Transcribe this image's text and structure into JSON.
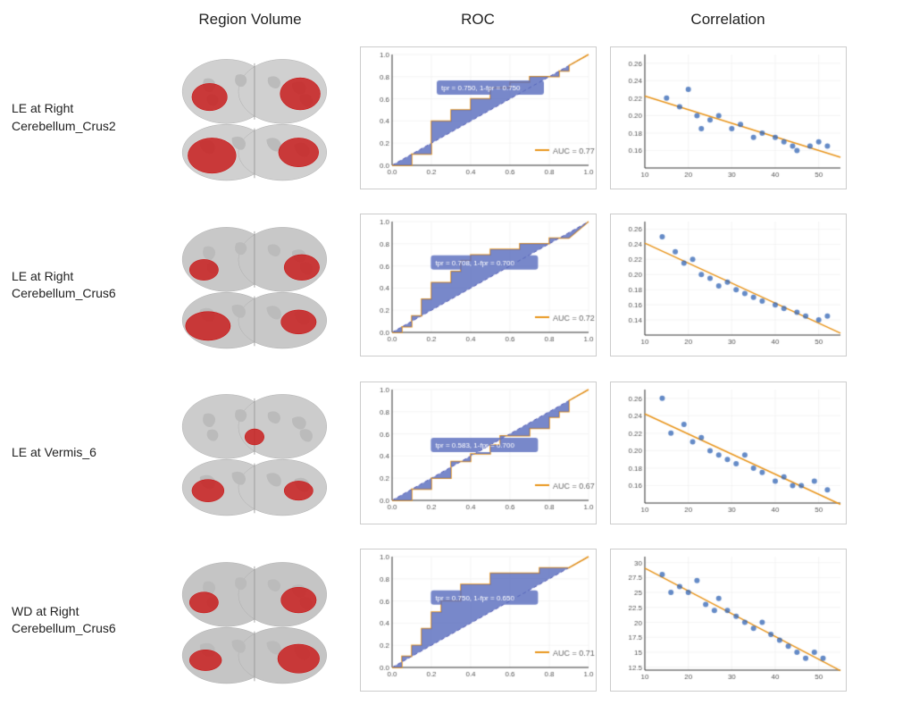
{
  "header": {
    "col1": "",
    "col2": "Region Volume",
    "col3": "ROC",
    "col4": "Correlation"
  },
  "rows": [
    {
      "label_line1": "LE at Right",
      "label_line2": "Cerebellum_Crus2",
      "roc": {
        "tpr_label": "tpr = 0.750, 1-fpr = 0.750",
        "tpr_x_pct": 25,
        "tpr_y_pct": 62,
        "auc": "AUC = 0.77",
        "steps": [
          [
            0,
            0
          ],
          [
            0.1,
            0
          ],
          [
            0.1,
            0.1
          ],
          [
            0.2,
            0.1
          ],
          [
            0.2,
            0.4
          ],
          [
            0.3,
            0.4
          ],
          [
            0.3,
            0.5
          ],
          [
            0.4,
            0.5
          ],
          [
            0.4,
            0.6
          ],
          [
            0.5,
            0.6
          ],
          [
            0.5,
            0.7
          ],
          [
            0.6,
            0.7
          ],
          [
            0.6,
            0.75
          ],
          [
            0.7,
            0.75
          ],
          [
            0.7,
            0.8
          ],
          [
            0.8,
            0.8
          ],
          [
            0.85,
            0.8
          ],
          [
            0.85,
            0.85
          ],
          [
            0.9,
            0.85
          ],
          [
            0.9,
            0.9
          ],
          [
            1.0,
            1.0
          ]
        ]
      },
      "scatter": {
        "x_min": 10,
        "x_max": 55,
        "y_min": 0.14,
        "y_max": 0.27,
        "y_ticks": [
          0.16,
          0.18,
          0.2,
          0.22,
          0.24,
          0.26
        ],
        "x_ticks": [
          10,
          20,
          30,
          40,
          50
        ],
        "points": [
          [
            15,
            0.22
          ],
          [
            18,
            0.21
          ],
          [
            20,
            0.23
          ],
          [
            22,
            0.2
          ],
          [
            23,
            0.185
          ],
          [
            25,
            0.195
          ],
          [
            27,
            0.2
          ],
          [
            30,
            0.185
          ],
          [
            32,
            0.19
          ],
          [
            35,
            0.175
          ],
          [
            37,
            0.18
          ],
          [
            40,
            0.175
          ],
          [
            42,
            0.17
          ],
          [
            44,
            0.165
          ],
          [
            45,
            0.16
          ],
          [
            48,
            0.165
          ],
          [
            50,
            0.17
          ],
          [
            52,
            0.165
          ]
        ],
        "trend": true
      }
    },
    {
      "label_line1": "LE at Right",
      "label_line2": "Cerebellum_Crus6",
      "roc": {
        "tpr_label": "tpr = 0.708, 1-fpr = 0.700",
        "tpr_x_pct": 22,
        "tpr_y_pct": 55,
        "auc": "AUC = 0.72",
        "steps": [
          [
            0,
            0
          ],
          [
            0.05,
            0
          ],
          [
            0.05,
            0.05
          ],
          [
            0.1,
            0.05
          ],
          [
            0.1,
            0.15
          ],
          [
            0.15,
            0.15
          ],
          [
            0.15,
            0.3
          ],
          [
            0.2,
            0.3
          ],
          [
            0.2,
            0.45
          ],
          [
            0.25,
            0.45
          ],
          [
            0.3,
            0.45
          ],
          [
            0.3,
            0.55
          ],
          [
            0.35,
            0.55
          ],
          [
            0.35,
            0.65
          ],
          [
            0.4,
            0.65
          ],
          [
            0.4,
            0.7
          ],
          [
            0.5,
            0.7
          ],
          [
            0.5,
            0.75
          ],
          [
            0.6,
            0.75
          ],
          [
            0.65,
            0.75
          ],
          [
            0.65,
            0.8
          ],
          [
            0.8,
            0.8
          ],
          [
            0.8,
            0.85
          ],
          [
            0.9,
            0.85
          ],
          [
            1.0,
            1.0
          ]
        ]
      },
      "scatter": {
        "x_min": 10,
        "x_max": 55,
        "y_min": 0.12,
        "y_max": 0.27,
        "y_ticks": [
          0.14,
          0.16,
          0.18,
          0.2,
          0.22,
          0.24,
          0.26
        ],
        "x_ticks": [
          10,
          20,
          30,
          40,
          50
        ],
        "points": [
          [
            14,
            0.25
          ],
          [
            17,
            0.23
          ],
          [
            19,
            0.215
          ],
          [
            21,
            0.22
          ],
          [
            23,
            0.2
          ],
          [
            25,
            0.195
          ],
          [
            27,
            0.185
          ],
          [
            29,
            0.19
          ],
          [
            31,
            0.18
          ],
          [
            33,
            0.175
          ],
          [
            35,
            0.17
          ],
          [
            37,
            0.165
          ],
          [
            40,
            0.16
          ],
          [
            42,
            0.155
          ],
          [
            45,
            0.15
          ],
          [
            47,
            0.145
          ],
          [
            50,
            0.14
          ],
          [
            52,
            0.145
          ]
        ],
        "trend": true
      }
    },
    {
      "label_line1": "LE at Vermis_6",
      "label_line2": "",
      "roc": {
        "tpr_label": "tpr = 0.583, 1-fpr = 0.700",
        "tpr_x_pct": 22,
        "tpr_y_pct": 42,
        "auc": "AUC = 0.67",
        "steps": [
          [
            0,
            0
          ],
          [
            0.1,
            0
          ],
          [
            0.1,
            0.1
          ],
          [
            0.2,
            0.1
          ],
          [
            0.2,
            0.2
          ],
          [
            0.3,
            0.2
          ],
          [
            0.3,
            0.35
          ],
          [
            0.4,
            0.35
          ],
          [
            0.4,
            0.42
          ],
          [
            0.5,
            0.42
          ],
          [
            0.5,
            0.5
          ],
          [
            0.55,
            0.5
          ],
          [
            0.55,
            0.583
          ],
          [
            0.7,
            0.583
          ],
          [
            0.7,
            0.65
          ],
          [
            0.8,
            0.65
          ],
          [
            0.8,
            0.75
          ],
          [
            0.85,
            0.75
          ],
          [
            0.85,
            0.8
          ],
          [
            0.9,
            0.8
          ],
          [
            0.9,
            0.9
          ],
          [
            1.0,
            1.0
          ]
        ]
      },
      "scatter": {
        "x_min": 10,
        "x_max": 55,
        "y_min": 0.14,
        "y_max": 0.27,
        "y_ticks": [
          0.16,
          0.18,
          0.2,
          0.22,
          0.24,
          0.26
        ],
        "x_ticks": [
          10,
          20,
          30,
          40,
          50
        ],
        "points": [
          [
            14,
            0.26
          ],
          [
            16,
            0.22
          ],
          [
            19,
            0.23
          ],
          [
            21,
            0.21
          ],
          [
            23,
            0.215
          ],
          [
            25,
            0.2
          ],
          [
            27,
            0.195
          ],
          [
            29,
            0.19
          ],
          [
            31,
            0.185
          ],
          [
            33,
            0.195
          ],
          [
            35,
            0.18
          ],
          [
            37,
            0.175
          ],
          [
            40,
            0.165
          ],
          [
            42,
            0.17
          ],
          [
            44,
            0.16
          ],
          [
            46,
            0.16
          ],
          [
            49,
            0.165
          ],
          [
            52,
            0.155
          ]
        ],
        "trend": true
      }
    },
    {
      "label_line1": "WD at Right",
      "label_line2": "Cerebellum_Crus6",
      "roc": {
        "tpr_label": "tpr = 0.750, 1-fpr = 0.650",
        "tpr_x_pct": 22,
        "tpr_y_pct": 55,
        "auc": "AUC = 0.71",
        "steps": [
          [
            0,
            0
          ],
          [
            0.05,
            0
          ],
          [
            0.05,
            0.1
          ],
          [
            0.1,
            0.1
          ],
          [
            0.1,
            0.2
          ],
          [
            0.15,
            0.2
          ],
          [
            0.15,
            0.35
          ],
          [
            0.2,
            0.35
          ],
          [
            0.2,
            0.5
          ],
          [
            0.25,
            0.5
          ],
          [
            0.25,
            0.6
          ],
          [
            0.3,
            0.6
          ],
          [
            0.35,
            0.6
          ],
          [
            0.35,
            0.75
          ],
          [
            0.4,
            0.75
          ],
          [
            0.5,
            0.75
          ],
          [
            0.5,
            0.85
          ],
          [
            0.6,
            0.85
          ],
          [
            0.7,
            0.85
          ],
          [
            0.75,
            0.85
          ],
          [
            0.75,
            0.9
          ],
          [
            0.9,
            0.9
          ],
          [
            1.0,
            1.0
          ]
        ]
      },
      "scatter": {
        "x_min": 10,
        "x_max": 55,
        "y_min": 12,
        "y_max": 31,
        "y_ticks": [
          12.5,
          15.0,
          17.5,
          20.0,
          22.5,
          25.0,
          27.5,
          30.0
        ],
        "x_ticks": [
          10,
          20,
          30,
          40,
          50
        ],
        "points": [
          [
            14,
            28
          ],
          [
            16,
            25
          ],
          [
            18,
            26
          ],
          [
            20,
            25
          ],
          [
            22,
            27
          ],
          [
            24,
            23
          ],
          [
            26,
            22
          ],
          [
            27,
            24
          ],
          [
            29,
            22
          ],
          [
            31,
            21
          ],
          [
            33,
            20
          ],
          [
            35,
            19
          ],
          [
            37,
            20
          ],
          [
            39,
            18
          ],
          [
            41,
            17
          ],
          [
            43,
            16
          ],
          [
            45,
            15
          ],
          [
            47,
            14
          ],
          [
            49,
            15
          ],
          [
            51,
            14
          ]
        ],
        "trend": true
      }
    }
  ]
}
